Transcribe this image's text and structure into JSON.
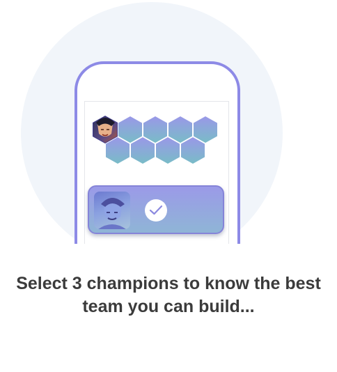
{
  "illustration": {
    "icons": {
      "selected_champion": "champion-portrait-icon",
      "card_champion": "champion-portrait-icon",
      "check": "check-icon"
    },
    "colors": {
      "phone_outline": "#8d8ae6",
      "hex_top": "#9a98e8",
      "hex_bottom": "#79bcc7",
      "background_circle": "#f1f5fa"
    },
    "team_slots_filled": 1,
    "team_slots_total": 10
  },
  "caption": {
    "line1": "Select 3 champions to know the best",
    "line2": "team you can build..."
  }
}
